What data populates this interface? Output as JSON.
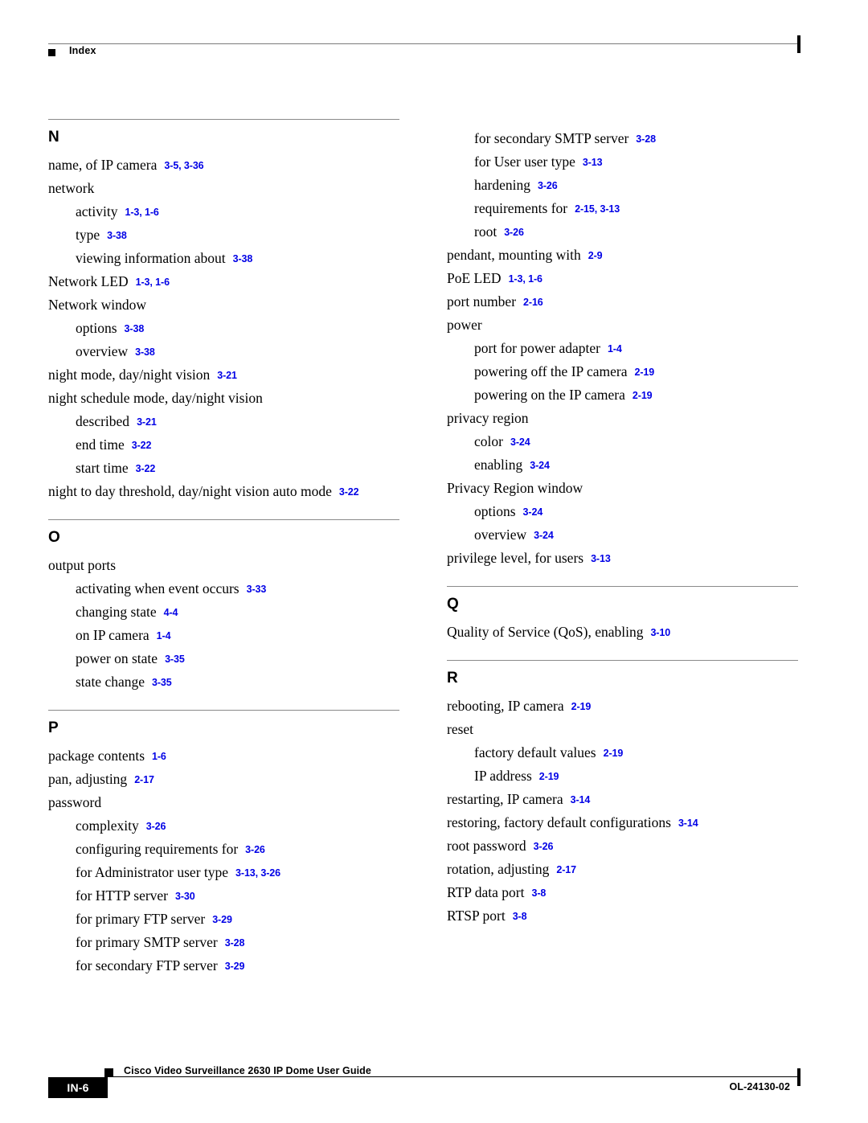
{
  "header": {
    "title": "Index",
    "bullet_icon": "black-square-bullet"
  },
  "footer": {
    "page_number": "IN-6",
    "guide_title": "Cisco Video Surveillance 2630 IP Dome User Guide",
    "doc_id": "OL-24130-02",
    "bullet_icon": "black-square-bullet"
  },
  "colors": {
    "reference_link": "#0000E6",
    "rule": "#8a8a8a",
    "text": "#000000",
    "footer_box": "#000000"
  },
  "columns": [
    {
      "name": "left",
      "sections": [
        {
          "letter": "N",
          "entries": [
            {
              "level": 0,
              "term": "name, of IP camera",
              "refs": "3-5, 3-36"
            },
            {
              "level": 0,
              "term": "network",
              "refs": ""
            },
            {
              "level": 1,
              "term": "activity",
              "refs": "1-3, 1-6"
            },
            {
              "level": 1,
              "term": "type",
              "refs": "3-38"
            },
            {
              "level": 1,
              "term": "viewing information about",
              "refs": "3-38"
            },
            {
              "level": 0,
              "term": "Network LED",
              "refs": "1-3, 1-6"
            },
            {
              "level": 0,
              "term": "Network window",
              "refs": ""
            },
            {
              "level": 1,
              "term": "options",
              "refs": "3-38"
            },
            {
              "level": 1,
              "term": "overview",
              "refs": "3-38"
            },
            {
              "level": 0,
              "term": "night mode, day/night vision",
              "refs": "3-21"
            },
            {
              "level": 0,
              "term": "night schedule mode, day/night vision",
              "refs": ""
            },
            {
              "level": 1,
              "term": "described",
              "refs": "3-21"
            },
            {
              "level": 1,
              "term": "end time",
              "refs": "3-22"
            },
            {
              "level": 1,
              "term": "start time",
              "refs": "3-22"
            },
            {
              "level": 0,
              "term": "night to day threshold, day/night vision auto mode",
              "refs": "3-22"
            }
          ]
        },
        {
          "letter": "O",
          "entries": [
            {
              "level": 0,
              "term": "output ports",
              "refs": ""
            },
            {
              "level": 1,
              "term": "activating when event occurs",
              "refs": "3-33"
            },
            {
              "level": 1,
              "term": "changing state",
              "refs": "4-4"
            },
            {
              "level": 1,
              "term": "on IP camera",
              "refs": "1-4"
            },
            {
              "level": 1,
              "term": "power on state",
              "refs": "3-35"
            },
            {
              "level": 1,
              "term": "state change",
              "refs": "3-35"
            }
          ]
        },
        {
          "letter": "P",
          "entries": [
            {
              "level": 0,
              "term": "package contents",
              "refs": "1-6"
            },
            {
              "level": 0,
              "term": "pan, adjusting",
              "refs": "2-17"
            },
            {
              "level": 0,
              "term": "password",
              "refs": ""
            },
            {
              "level": 1,
              "term": "complexity",
              "refs": "3-26"
            },
            {
              "level": 1,
              "term": "configuring requirements for",
              "refs": "3-26"
            },
            {
              "level": 1,
              "term": "for Administrator user type",
              "refs": "3-13, 3-26"
            },
            {
              "level": 1,
              "term": "for HTTP server",
              "refs": "3-30"
            },
            {
              "level": 1,
              "term": "for primary FTP server",
              "refs": "3-29"
            },
            {
              "level": 1,
              "term": "for primary SMTP server",
              "refs": "3-28"
            },
            {
              "level": 1,
              "term": "for secondary FTP server",
              "refs": "3-29"
            }
          ]
        }
      ]
    },
    {
      "name": "right",
      "sections": [
        {
          "letter": "",
          "entries": [
            {
              "level": 1,
              "term": "for secondary SMTP server",
              "refs": "3-28"
            },
            {
              "level": 1,
              "term": "for User user type",
              "refs": "3-13"
            },
            {
              "level": 1,
              "term": "hardening",
              "refs": "3-26"
            },
            {
              "level": 1,
              "term": "requirements for",
              "refs": "2-15, 3-13"
            },
            {
              "level": 1,
              "term": "root",
              "refs": "3-26"
            },
            {
              "level": 0,
              "term": "pendant, mounting with",
              "refs": "2-9"
            },
            {
              "level": 0,
              "term": "PoE LED",
              "refs": "1-3, 1-6"
            },
            {
              "level": 0,
              "term": "port number",
              "refs": "2-16"
            },
            {
              "level": 0,
              "term": "power",
              "refs": ""
            },
            {
              "level": 1,
              "term": "port for power adapter",
              "refs": "1-4"
            },
            {
              "level": 1,
              "term": "powering off the IP camera",
              "refs": "2-19"
            },
            {
              "level": 1,
              "term": "powering on the IP camera",
              "refs": "2-19"
            },
            {
              "level": 0,
              "term": "privacy region",
              "refs": ""
            },
            {
              "level": 1,
              "term": "color",
              "refs": "3-24"
            },
            {
              "level": 1,
              "term": "enabling",
              "refs": "3-24"
            },
            {
              "level": 0,
              "term": "Privacy Region window",
              "refs": ""
            },
            {
              "level": 1,
              "term": "options",
              "refs": "3-24"
            },
            {
              "level": 1,
              "term": "overview",
              "refs": "3-24"
            },
            {
              "level": 0,
              "term": "privilege level, for users",
              "refs": "3-13"
            }
          ]
        },
        {
          "letter": "Q",
          "entries": [
            {
              "level": 0,
              "term": "Quality of Service (QoS), enabling",
              "refs": "3-10"
            }
          ]
        },
        {
          "letter": "R",
          "entries": [
            {
              "level": 0,
              "term": "rebooting, IP camera",
              "refs": "2-19"
            },
            {
              "level": 0,
              "term": "reset",
              "refs": ""
            },
            {
              "level": 1,
              "term": "factory default values",
              "refs": "2-19"
            },
            {
              "level": 1,
              "term": "IP address",
              "refs": "2-19"
            },
            {
              "level": 0,
              "term": "restarting, IP camera",
              "refs": "3-14"
            },
            {
              "level": 0,
              "term": "restoring, factory default configurations",
              "refs": "3-14"
            },
            {
              "level": 0,
              "term": "root password",
              "refs": "3-26"
            },
            {
              "level": 0,
              "term": "rotation, adjusting",
              "refs": "2-17"
            },
            {
              "level": 0,
              "term": "RTP data port",
              "refs": "3-8"
            },
            {
              "level": 0,
              "term": "RTSP port",
              "refs": "3-8"
            }
          ]
        }
      ]
    }
  ]
}
